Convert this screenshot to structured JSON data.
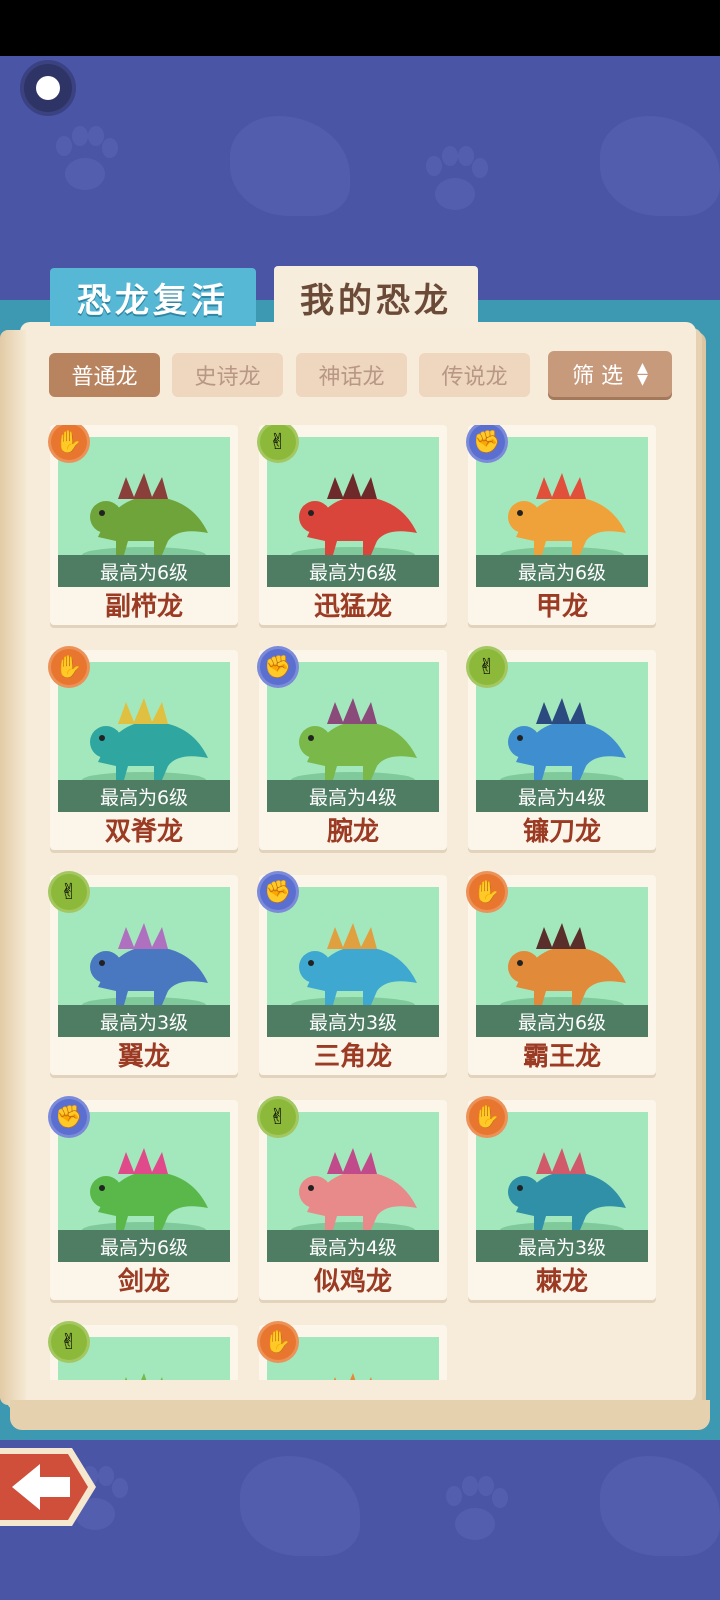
{
  "tabs": {
    "revive": "恐龙复活",
    "mine": "我的恐龙"
  },
  "filters": [
    {
      "label": "普通龙",
      "active": true
    },
    {
      "label": "史诗龙",
      "active": false
    },
    {
      "label": "神话龙",
      "active": false
    },
    {
      "label": "传说龙",
      "active": false
    }
  ],
  "filter_button": "筛 选",
  "dinosaurs": [
    {
      "name": "副栉龙",
      "level": "最高为6级",
      "badge": "orange",
      "icon": "paper-hand-icon",
      "color": "#6fa43a",
      "accent": "#8b3f3a"
    },
    {
      "name": "迅猛龙",
      "level": "最高为6级",
      "badge": "green",
      "icon": "scissors-hand-icon",
      "color": "#d9453a",
      "accent": "#6e2a2a"
    },
    {
      "name": "甲龙",
      "level": "最高为6级",
      "badge": "blue",
      "icon": "rock-hand-icon",
      "color": "#f0a23a",
      "accent": "#e0503a"
    },
    {
      "name": "双脊龙",
      "level": "最高为6级",
      "badge": "orange",
      "icon": "paper-hand-icon",
      "color": "#2fa6a0",
      "accent": "#e0c040"
    },
    {
      "name": "腕龙",
      "level": "最高为4级",
      "badge": "blue",
      "icon": "rock-hand-icon",
      "color": "#7ab84a",
      "accent": "#8a4a7a"
    },
    {
      "name": "镰刀龙",
      "level": "最高为4级",
      "badge": "green",
      "icon": "scissors-hand-icon",
      "color": "#3f8fd0",
      "accent": "#2b4a80"
    },
    {
      "name": "翼龙",
      "level": "最高为3级",
      "badge": "green",
      "icon": "scissors-hand-icon",
      "color": "#4a78c0",
      "accent": "#b070c0"
    },
    {
      "name": "三角龙",
      "level": "最高为3级",
      "badge": "blue",
      "icon": "rock-hand-icon",
      "color": "#3fa8d0",
      "accent": "#e0a040"
    },
    {
      "name": "霸王龙",
      "level": "最高为6级",
      "badge": "orange",
      "icon": "paper-hand-icon",
      "color": "#e08a3a",
      "accent": "#5a2e2a"
    },
    {
      "name": "剑龙",
      "level": "最高为6级",
      "badge": "blue",
      "icon": "rock-hand-icon",
      "color": "#5ab84a",
      "accent": "#e04a8a"
    },
    {
      "name": "似鸡龙",
      "level": "最高为4级",
      "badge": "green",
      "icon": "scissors-hand-icon",
      "color": "#e88a8a",
      "accent": "#c04a8a"
    },
    {
      "name": "棘龙",
      "level": "最高为3级",
      "badge": "orange",
      "icon": "paper-hand-icon",
      "color": "#2f90a8",
      "accent": "#d05a6a"
    },
    {
      "name": "",
      "level": "",
      "badge": "green",
      "icon": "scissors-hand-icon",
      "color": "#7ab84a",
      "accent": "#7ab84a"
    },
    {
      "name": "",
      "level": "",
      "badge": "orange",
      "icon": "paper-hand-icon",
      "color": "#e08a3a",
      "accent": "#e08a3a"
    }
  ],
  "colors": {
    "background": "#4b55a6",
    "book_page": "#f7ecda",
    "card_image_bg": "#a3e8bd",
    "name_text": "#9b3b24"
  }
}
